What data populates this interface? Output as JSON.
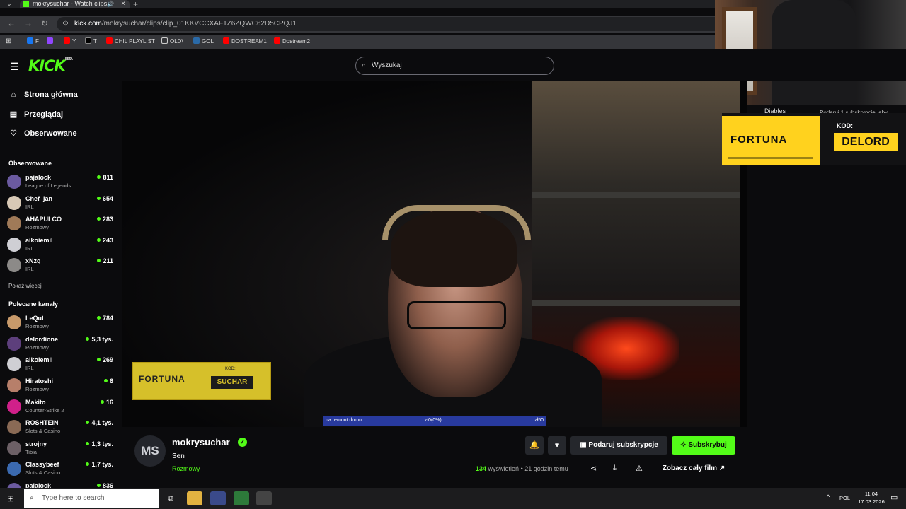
{
  "browser": {
    "tab_title": "mokrysuchar - Watch clips",
    "close": "×",
    "new_tab": "+",
    "url_domain": "kick.com",
    "url_path": "/mokrysuchar/clips/clip_01KKVCCXAF1Z6ZQWC62D5CPQJ1",
    "bookmarks": [
      "F",
      "",
      "Y",
      "T",
      "CHIL PLAYLIST",
      "OLD\\",
      "GOL",
      "DOSTREAM1",
      "Dostream2"
    ]
  },
  "kick": {
    "logo": "KICK",
    "beta": "BETA",
    "search_placeholder": "Wyszukaj",
    "nav": [
      "Strona główna",
      "Przeglądaj",
      "Obserwowane"
    ],
    "followed_title": "Obserwowane",
    "followed": [
      {
        "name": "pajalock",
        "category": "League of Legends",
        "viewers": "811",
        "color": "#6b5aa0"
      },
      {
        "name": "Chef_jan",
        "category": "IRL",
        "viewers": "654",
        "color": "#d8c9b6"
      },
      {
        "name": "AHAPULCO",
        "category": "Rozmowy",
        "viewers": "283",
        "color": "#a07a58"
      },
      {
        "name": "aikoiemil",
        "category": "IRL",
        "viewers": "243",
        "color": "#cfcfd4"
      },
      {
        "name": "xNzq",
        "category": "IRL",
        "viewers": "211",
        "color": "#8c8a88"
      }
    ],
    "show_more": "Pokaż więcej",
    "recommended_title": "Polecane kanały",
    "recommended": [
      {
        "name": "LeQut",
        "category": "Rozmowy",
        "viewers": "784",
        "color": "#c89a6a"
      },
      {
        "name": "delordione",
        "category": "Rozmowy",
        "viewers": "5,3 tys.",
        "color": "#5d3f7c"
      },
      {
        "name": "aikoiemil",
        "category": "IRL",
        "viewers": "269",
        "color": "#cfcfd4"
      },
      {
        "name": "Hiratoshi",
        "category": "Rozmowy",
        "viewers": "6",
        "color": "#b77f6a"
      },
      {
        "name": "Makito",
        "category": "Counter-Strike 2",
        "viewers": "16",
        "color": "#d0208a"
      },
      {
        "name": "ROSHTEIN",
        "category": "Slots & Casino",
        "viewers": "4,1 tys.",
        "color": "#8a6a55"
      },
      {
        "name": "strojny",
        "category": "Tibia",
        "viewers": "1,3 tys.",
        "color": "#6c6066"
      },
      {
        "name": "Classybeef",
        "category": "Slots & Casino",
        "viewers": "1,7 tys.",
        "color": "#3b6ab0"
      },
      {
        "name": "pajalock",
        "category": "",
        "viewers": "836",
        "color": "#6b5aa0"
      }
    ]
  },
  "video": {
    "goal_label": "na remont domu",
    "goal_progress": "zł0(0%)",
    "goal_target": "zł50",
    "fortuna_video": "FORTUNA",
    "fortuna_video_kod": "KOD:",
    "fortuna_video_code": "SUCHAR",
    "fortuna_ad": "FORTUNA",
    "fortuna_ad_kod": "KOD:",
    "fortuna_ad_code": "DELORD",
    "diables": "Diables",
    "sub_line": "Podaruj 1 subskrypcję, aby"
  },
  "channel": {
    "initials": "MS",
    "name": "mokrysuchar",
    "clip_title": "Sen",
    "category": "Rozmowy",
    "gift_label": "Podaruj subskrypcje",
    "sub_label": "Subskrybuj",
    "views_count": "134",
    "views_word": "wyświetleń",
    "time_ago": "21 godzin temu",
    "full_video_label": "Zobacz cały film"
  },
  "taskbar": {
    "search_placeholder": "Type here to search",
    "lang": "POL",
    "time": "11:04",
    "date": "17.03.2026"
  },
  "colors": {
    "accent": "#53fc18",
    "background": "#0b0b0d",
    "goal_bar": "#283a9e",
    "fortuna": "#ffd21e"
  }
}
